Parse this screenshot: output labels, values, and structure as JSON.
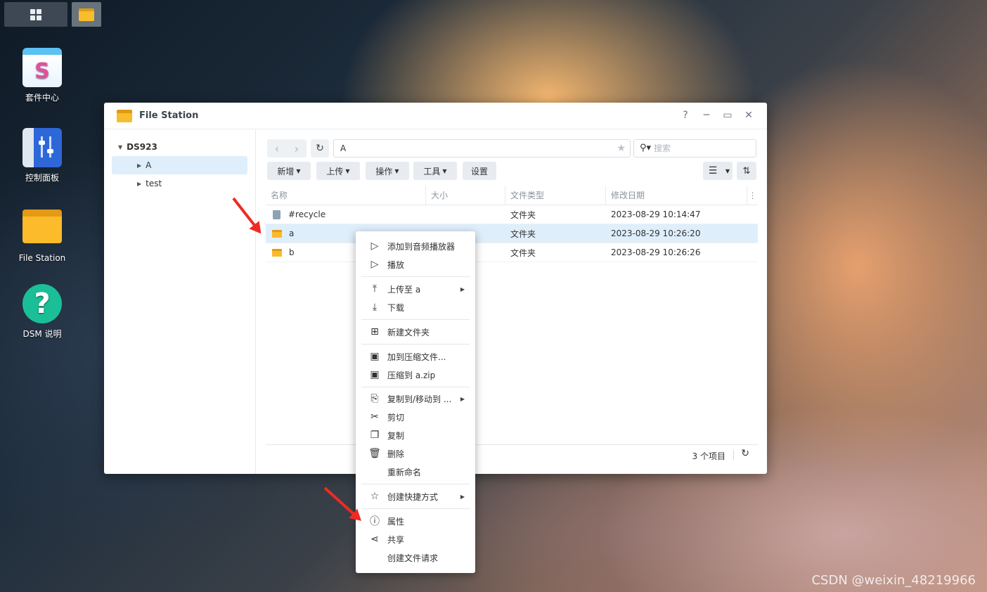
{
  "desktop": {
    "icons": [
      {
        "label": "套件中心"
      },
      {
        "label": "控制面板"
      },
      {
        "label": "File Station"
      },
      {
        "label": "DSM 说明"
      }
    ]
  },
  "window": {
    "title": "File Station",
    "controls": {
      "help": "?",
      "minimize": "─",
      "maximize": "▭",
      "close": "✕"
    },
    "tree": {
      "root": "DS923",
      "children": [
        {
          "label": "A"
        },
        {
          "label": "test"
        }
      ]
    },
    "path": "A",
    "search_placeholder": "搜索",
    "toolbar": {
      "create": "新增",
      "upload": "上传",
      "action": "操作",
      "tools": "工具",
      "settings": "设置"
    },
    "columns": [
      "名称",
      "大小",
      "文件类型",
      "修改日期"
    ],
    "rows": [
      {
        "name": "#recycle",
        "size": "",
        "type": "文件夹",
        "modified": "2023-08-29 10:14:47"
      },
      {
        "name": "a",
        "size": "",
        "type": "文件夹",
        "modified": "2023-08-29 10:26:20"
      },
      {
        "name": "b",
        "size": "",
        "type": "文件夹",
        "modified": "2023-08-29 10:26:26"
      }
    ],
    "status": {
      "count": "3 个项目"
    }
  },
  "context_menu": {
    "items": [
      {
        "label": "添加到音频播放器",
        "icon": "play-outline-icon"
      },
      {
        "label": "播放",
        "icon": "play-icon"
      },
      {
        "label": "上传至 a",
        "icon": "upload-icon"
      },
      {
        "label": "下载",
        "icon": "download-icon"
      },
      {
        "label": "新建文件夹",
        "icon": "new-folder-icon"
      },
      {
        "label": "加到压缩文件...",
        "icon": "archive-icon"
      },
      {
        "label": "压缩到 a.zip",
        "icon": "zip-icon"
      },
      {
        "label": "复制到/移动到 ...",
        "icon": "copy-move-icon"
      },
      {
        "label": "剪切",
        "icon": "scissors-icon"
      },
      {
        "label": "复制",
        "icon": "copy-icon"
      },
      {
        "label": "删除",
        "icon": "trash-icon"
      },
      {
        "label": "重新命名",
        "icon": ""
      },
      {
        "label": "创建快捷方式",
        "icon": "star-icon"
      },
      {
        "label": "属性",
        "icon": "info-icon"
      },
      {
        "label": "共享",
        "icon": "share-icon"
      },
      {
        "label": "创建文件请求",
        "icon": ""
      }
    ]
  },
  "watermark": "CSDN @weixin_48219966",
  "colors": {
    "selection": "#dfeefb",
    "folder": "#f9bb29",
    "annotation_arrow": "#ee2a24"
  }
}
